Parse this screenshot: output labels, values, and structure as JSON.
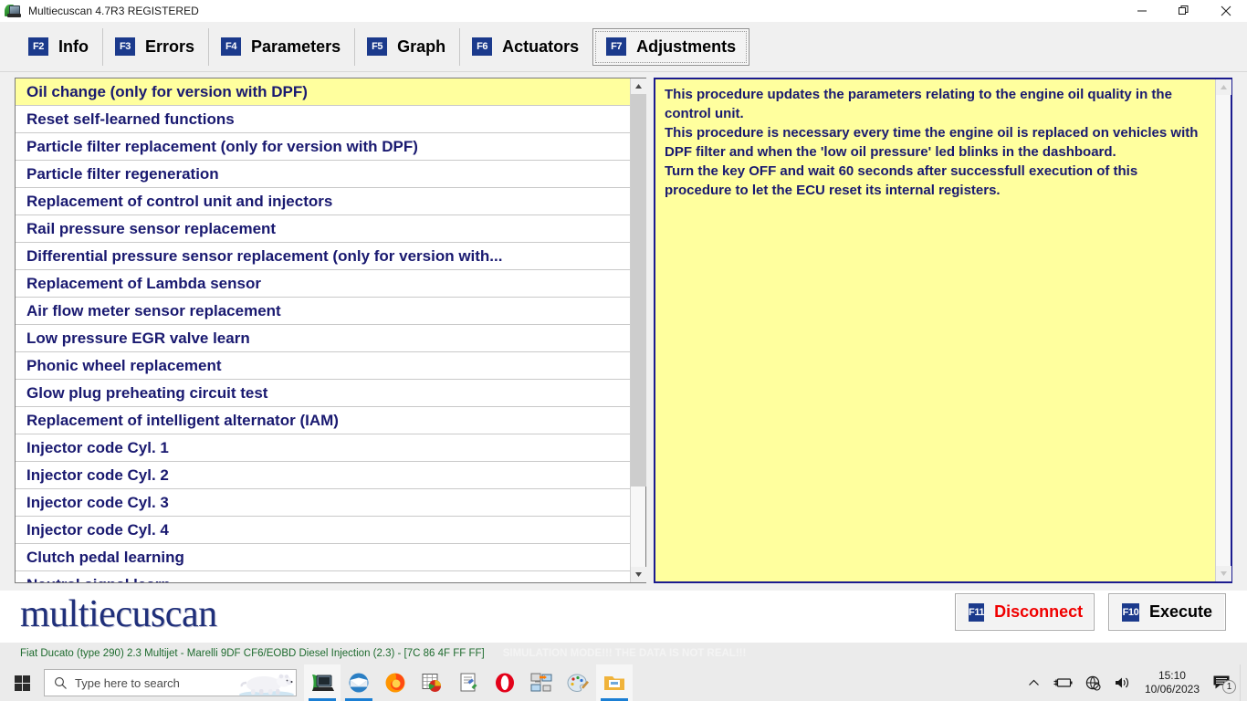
{
  "window": {
    "title": "Multiecuscan 4.7R3 REGISTERED",
    "icon": "multiecuscan-app-icon",
    "controls": {
      "minimize": "—",
      "restore": "❐",
      "close": "✕"
    }
  },
  "tabs": [
    {
      "fkey": "F2",
      "label": "Info",
      "active": false
    },
    {
      "fkey": "F3",
      "label": "Errors",
      "active": false
    },
    {
      "fkey": "F4",
      "label": "Parameters",
      "active": false
    },
    {
      "fkey": "F5",
      "label": "Graph",
      "active": false
    },
    {
      "fkey": "F6",
      "label": "Actuators",
      "active": false
    },
    {
      "fkey": "F7",
      "label": "Adjustments",
      "active": true
    }
  ],
  "adjustments_list": {
    "selected_index": 0,
    "items": [
      "Oil change (only for version with DPF)",
      "Reset self-learned functions",
      "Particle filter replacement (only for version with DPF)",
      "Particle filter regeneration",
      "Replacement of control unit and injectors",
      "Rail pressure sensor replacement",
      "Differential pressure sensor replacement (only for version with...",
      "Replacement of Lambda sensor",
      "Air flow meter sensor replacement",
      "Low pressure EGR valve learn",
      "Phonic wheel replacement",
      "Glow plug preheating circuit test",
      "Replacement of intelligent alternator (IAM)",
      "Injector code Cyl. 1",
      "Injector code Cyl. 2",
      "Injector code Cyl. 3",
      "Injector code Cyl. 4",
      "Clutch pedal learning",
      "Neutral signal learn"
    ]
  },
  "description": {
    "paragraphs": [
      "This procedure updates the parameters relating to the engine oil quality in the control unit.",
      "This procedure is necessary every time the engine oil is replaced on vehicles with DPF filter and when the 'low oil pressure' led blinks in the dashboard.",
      "Turn the key OFF and wait 60 seconds after successfull execution of this procedure to let the ECU reset its internal registers."
    ]
  },
  "footer": {
    "logo": "multiecuscan",
    "buttons": [
      {
        "fkey": "F11",
        "label": "Disconnect",
        "color": "#f00000"
      },
      {
        "fkey": "F10",
        "label": "Execute",
        "color": "#000000"
      }
    ]
  },
  "statusbar": {
    "vehicle": "Fiat Ducato (type 290) 2.3 Multijet - Marelli 9DF CF6/EOBD Diesel Injection (2.3) - [7C 86 4F FF FF]",
    "simulation_notice": "SIMULATION MODE!!! THE DATA IS NOT REAL!!!"
  },
  "taskbar": {
    "start": "windows-start-icon",
    "search_placeholder": "Type here to search",
    "search_value": "",
    "apps": [
      {
        "name": "multiecuscan",
        "active": true
      },
      {
        "name": "thunderbird",
        "active": false
      },
      {
        "name": "firefox",
        "active": false
      },
      {
        "name": "spreadsheet",
        "active": false
      },
      {
        "name": "document-editor",
        "active": false
      },
      {
        "name": "opera",
        "active": false
      },
      {
        "name": "network-tool",
        "active": false
      },
      {
        "name": "paint",
        "active": false
      },
      {
        "name": "file-explorer",
        "active": true
      }
    ],
    "tray": {
      "show_hidden": "chevron-up-icon",
      "battery": "battery-charging-icon",
      "network": "network-no-internet-icon",
      "volume": "speaker-icon",
      "time": "15:10",
      "date": "10/06/2023",
      "notifications": "1"
    }
  },
  "colors": {
    "accent_navy": "#1b3a8c",
    "list_text": "#191970",
    "selected_row": "#ffff9e",
    "panel_border": "#1b1b8f",
    "status_text": "#1f6b2f",
    "disconnect_red": "#f00000"
  }
}
